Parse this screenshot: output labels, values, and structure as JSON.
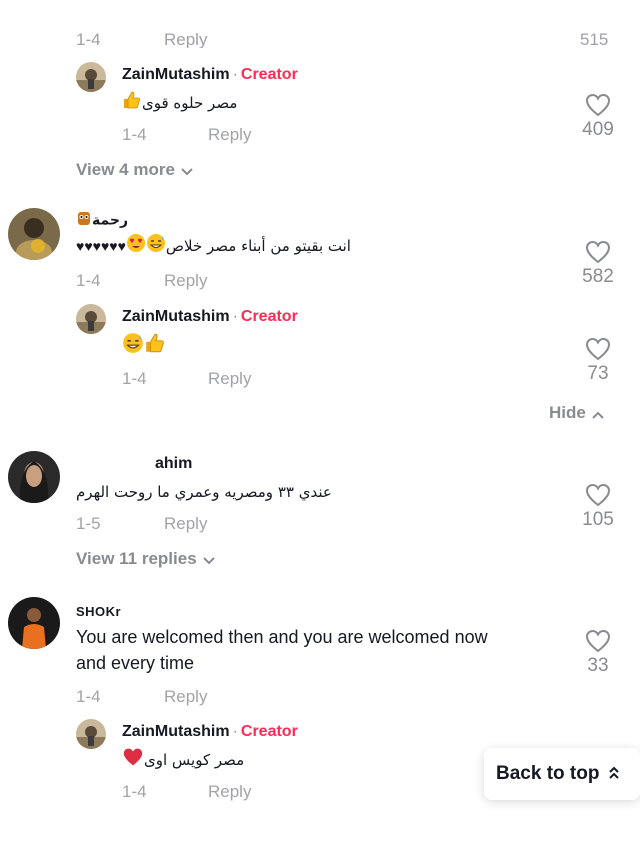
{
  "comments": [
    {
      "username": "ZainMutashim",
      "separator": "·",
      "badge": "Creator",
      "text": "مصر حلوه قوى",
      "emojis": [
        "thumbs-up"
      ],
      "date": "1-4",
      "reply_label": "Reply",
      "likes": "409",
      "is_reply": true
    },
    {
      "view_more": "View 4 more"
    },
    {
      "username": "رحمة",
      "emojis_name": [
        "owl"
      ],
      "text": "انت بقيتو من أبناء مصر خلاص",
      "emojis": [
        "grin-sweat",
        "heart-eyes"
      ],
      "hearts": "♥♥♥♥♥♥",
      "date": "1-4",
      "reply_label": "Reply",
      "likes": "582"
    },
    {
      "username": "ZainMutashim",
      "separator": "·",
      "badge": "Creator",
      "emojis": [
        "grin-sweat",
        "thumbs-up"
      ],
      "date": "1-4",
      "reply_label": "Reply",
      "likes": "73",
      "is_reply": true
    },
    {
      "hide_label": "Hide"
    },
    {
      "username": "ahim",
      "text": "عندي ٣٣ ومصريه وعمري ما روحت الهرم",
      "date": "1-5",
      "reply_label": "Reply",
      "likes": "105"
    },
    {
      "view_replies": "View 11 replies"
    },
    {
      "username": "SHOKr",
      "text_line1": "You are welcomed then and you are welcomed now",
      "text_line2": "and every time",
      "date": "1-4",
      "reply_label": "Reply",
      "likes": "33"
    },
    {
      "username": "ZainMutashim",
      "separator": "·",
      "badge": "Creator",
      "text": "مصر كويس اوى",
      "emojis": [
        "red-heart"
      ],
      "date": "1-4",
      "reply_label": "Reply",
      "is_reply": true
    }
  ],
  "back_to_top": "Back to top",
  "colors": {
    "creator": "#fe2c55",
    "muted": "#a2a3a8",
    "text": "#161823"
  }
}
